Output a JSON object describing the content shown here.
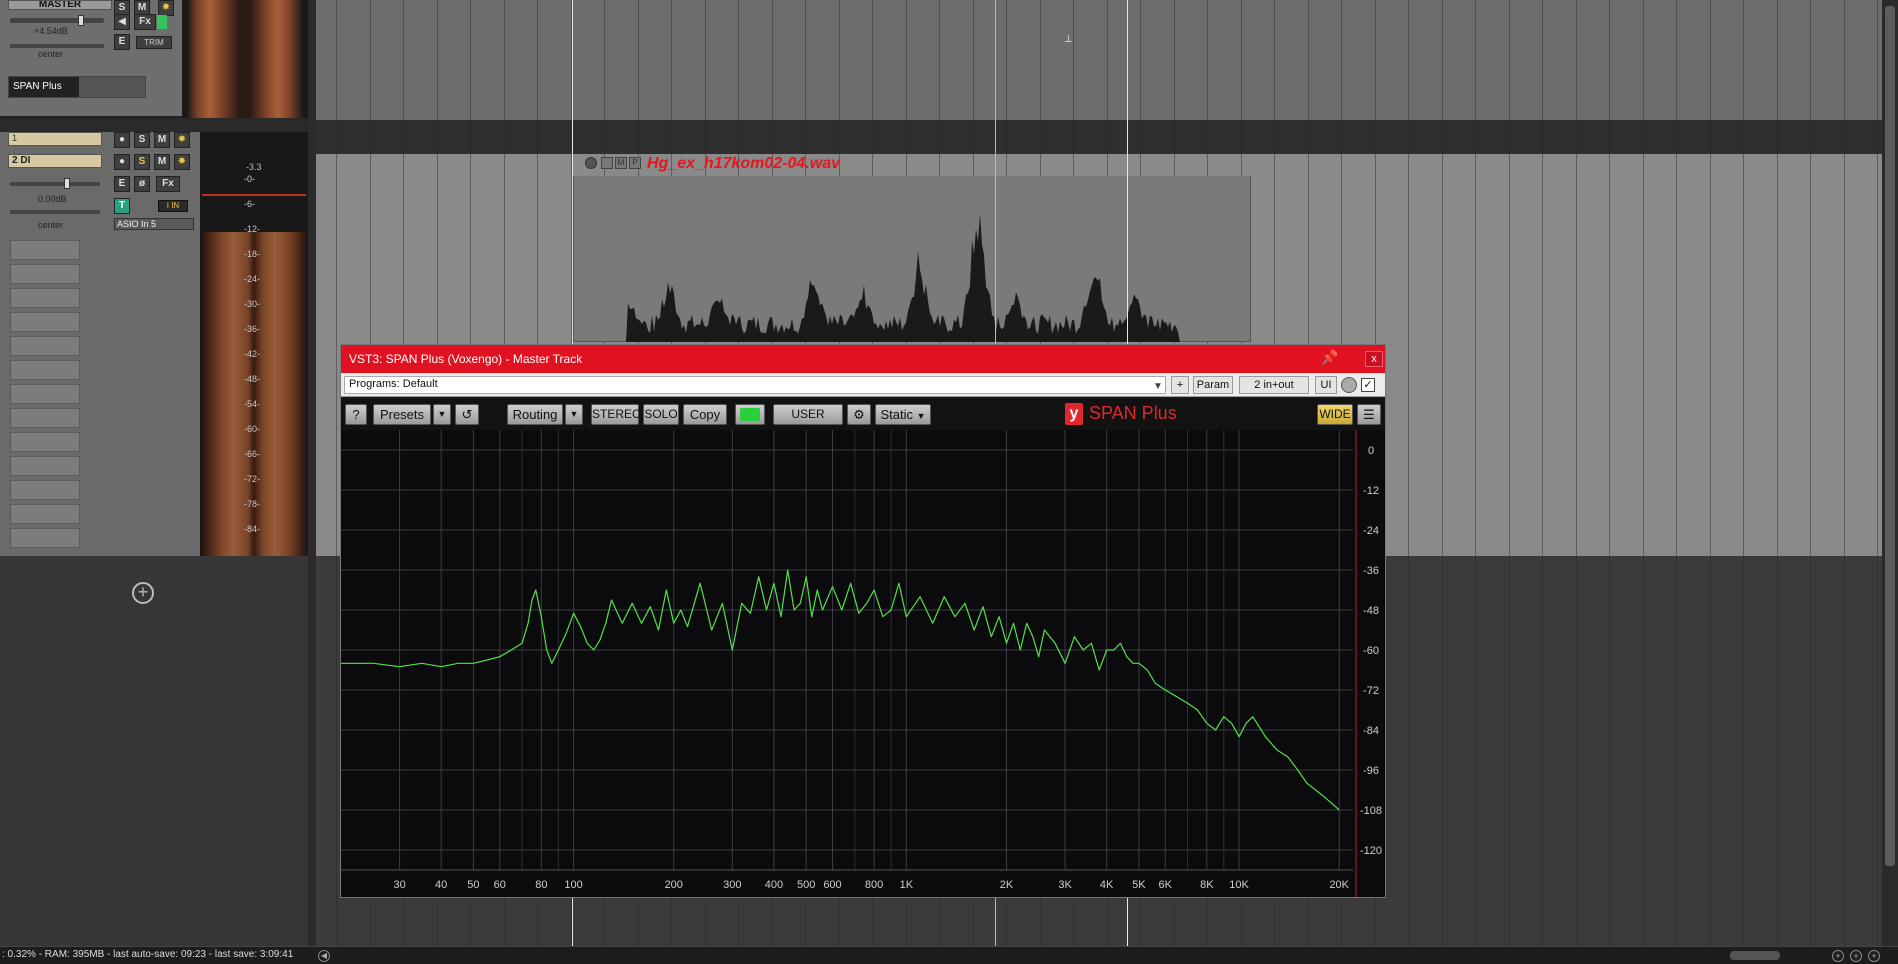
{
  "daw": {
    "master": {
      "name": "MASTER",
      "volume": "+4.54dB",
      "pan": "center",
      "fx_slot": "SPAN Plus",
      "trim": "TRIM"
    },
    "track1": {
      "number": "1"
    },
    "track2": {
      "number": "2",
      "name": "DI",
      "volume": "0.00dB",
      "pan": "center",
      "input": "ASIO In 5",
      "peak": "-3.3"
    },
    "meter_scale": [
      "-0-",
      "-6-",
      "-12-",
      "-18-",
      "-24-",
      "-30-",
      "-36-",
      "-42-",
      "-48-",
      "-54-",
      "-60-",
      "-66-",
      "-72-",
      "-78-",
      "-84-"
    ],
    "media_item": {
      "name": "Hg_ex_h17kom02-04.wav"
    },
    "status": ": 0.32% - RAM: 395MB - last auto-save: 09:23 - last save: 3:09:41"
  },
  "plugin": {
    "title": "VST3: SPAN Plus (Voxengo) - Master Track",
    "pin_icon": "pin-icon",
    "close_label": "x",
    "programs": "Programs: Default",
    "plus_label": "+",
    "param_label": "Param",
    "io_label": "2 in+out",
    "ui_label": "UI",
    "toolbar": {
      "help": "?",
      "presets": "Presets",
      "routing": "Routing",
      "stereo": "STEREO",
      "solo": "SOLO",
      "copy": "Copy",
      "user": "USER",
      "static": "Static",
      "wide": "WIDE"
    },
    "logo": "SPAN Plus",
    "colors": {
      "titlebar": "#e01221",
      "spectrum": "#55e04a",
      "wide": "#e3c64a"
    }
  },
  "chart_data": {
    "type": "line",
    "title": "",
    "xlabel": "",
    "ylabel": "",
    "x_scale": "log",
    "xlim": [
      20,
      22000
    ],
    "ylim": [
      -126,
      6
    ],
    "x_ticks": [
      {
        "v": 30,
        "label": "30"
      },
      {
        "v": 40,
        "label": "40"
      },
      {
        "v": 50,
        "label": "50"
      },
      {
        "v": 60,
        "label": "60"
      },
      {
        "v": 80,
        "label": "80"
      },
      {
        "v": 100,
        "label": "100"
      },
      {
        "v": 200,
        "label": "200"
      },
      {
        "v": 300,
        "label": "300"
      },
      {
        "v": 400,
        "label": "400"
      },
      {
        "v": 500,
        "label": "500"
      },
      {
        "v": 600,
        "label": "600"
      },
      {
        "v": 800,
        "label": "800"
      },
      {
        "v": 1000,
        "label": "1K"
      },
      {
        "v": 2000,
        "label": "2K"
      },
      {
        "v": 3000,
        "label": "3K"
      },
      {
        "v": 4000,
        "label": "4K"
      },
      {
        "v": 5000,
        "label": "5K"
      },
      {
        "v": 6000,
        "label": "6K"
      },
      {
        "v": 8000,
        "label": "8K"
      },
      {
        "v": 10000,
        "label": "10K"
      },
      {
        "v": 20000,
        "label": "20K"
      }
    ],
    "y_ticks": [
      0,
      -12,
      -24,
      -36,
      -48,
      -60,
      -72,
      -84,
      -96,
      -108,
      -120
    ],
    "minor_x": [
      70,
      90,
      700,
      900,
      7000,
      9000
    ],
    "series": [
      {
        "x": [
          20,
          25,
          30,
          35,
          40,
          45,
          50,
          55,
          60,
          65,
          70,
          73,
          75,
          77,
          80,
          83,
          86,
          90,
          95,
          100,
          105,
          110,
          115,
          120,
          125,
          130,
          140,
          150,
          160,
          170,
          180,
          190,
          200,
          210,
          220,
          240,
          260,
          280,
          300,
          320,
          340,
          360,
          380,
          400,
          420,
          440,
          460,
          480,
          500,
          520,
          540,
          560,
          600,
          640,
          680,
          720,
          760,
          800,
          850,
          900,
          950,
          1000,
          1100,
          1200,
          1300,
          1400,
          1500,
          1600,
          1700,
          1800,
          1900,
          2000,
          2100,
          2200,
          2300,
          2400,
          2500,
          2600,
          2800,
          3000,
          3200,
          3400,
          3600,
          3800,
          4000,
          4200,
          4400,
          4600,
          4800,
          5000,
          5300,
          5600,
          6000,
          6500,
          7000,
          7500,
          8000,
          8500,
          9000,
          9500,
          10000,
          10500,
          11000,
          12000,
          13000,
          14000,
          15000,
          16000,
          17000,
          18000,
          19000,
          20000
        ],
        "y": [
          -64,
          -64,
          -65,
          -64,
          -65,
          -64,
          -64,
          -63,
          -62,
          -60,
          -58,
          -52,
          -45,
          -42,
          -50,
          -60,
          -64,
          -60,
          -55,
          -49,
          -53,
          -58,
          -60,
          -57,
          -52,
          -45,
          -52,
          -46,
          -52,
          -47,
          -54,
          -42,
          -52,
          -48,
          -53,
          -40,
          -54,
          -46,
          -60,
          -46,
          -49,
          -38,
          -48,
          -40,
          -50,
          -36,
          -48,
          -46,
          -38,
          -50,
          -42,
          -48,
          -41,
          -48,
          -40,
          -49,
          -46,
          -42,
          -50,
          -48,
          -40,
          -50,
          -44,
          -52,
          -44,
          -50,
          -46,
          -54,
          -47,
          -56,
          -50,
          -58,
          -52,
          -60,
          -52,
          -56,
          -62,
          -54,
          -58,
          -64,
          -56,
          -60,
          -58,
          -66,
          -60,
          -60,
          -58,
          -62,
          -64,
          -64,
          -66,
          -70,
          -72,
          -74,
          -76,
          -78,
          -82,
          -84,
          -80,
          -82,
          -86,
          -82,
          -80,
          -86,
          -90,
          -92,
          -96,
          -100,
          -102,
          -104,
          -106,
          -108
        ]
      }
    ]
  }
}
